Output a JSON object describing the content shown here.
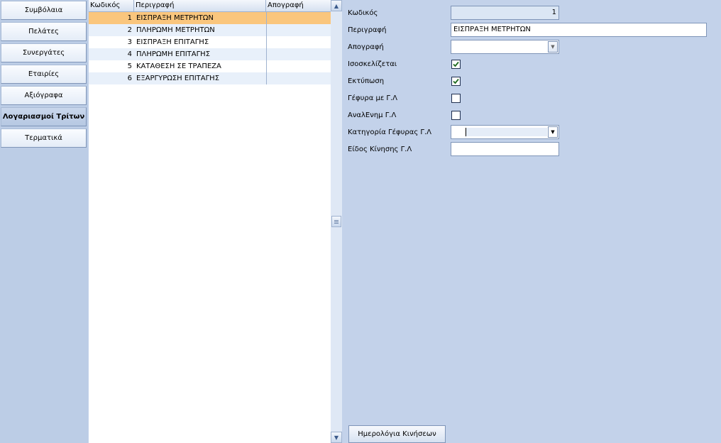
{
  "nav": {
    "items": [
      {
        "label": "Συμβόλαια"
      },
      {
        "label": "Πελάτες"
      },
      {
        "label": "Συνεργάτες"
      },
      {
        "label": "Εταιρίες"
      },
      {
        "label": "Αξιόγραφα"
      },
      {
        "label": "Λογαριασμοί Τρίτων",
        "active": true
      },
      {
        "label": "Τερματικά"
      }
    ]
  },
  "grid": {
    "columns": [
      "Κωδικός",
      "Περιγραφή",
      "Απογραφή"
    ],
    "rows": [
      {
        "code": "1",
        "description": "ΕΙΣΠΡΑΞΗ ΜΕΤΡΗΤΩΝ",
        "inventory": "",
        "selected": true
      },
      {
        "code": "2",
        "description": "ΠΛΗΡΩΜΗ ΜΕΤΡΗΤΩΝ",
        "inventory": ""
      },
      {
        "code": "3",
        "description": "ΕΙΣΠΡΑΞΗ ΕΠΙΤΑΓΗΣ",
        "inventory": ""
      },
      {
        "code": "4",
        "description": "ΠΛΗΡΩΜΗ ΕΠΙΤΑΓΗΣ",
        "inventory": ""
      },
      {
        "code": "5",
        "description": "ΚΑΤΑΘΕΣΗ ΣΕ ΤΡΑΠΕΖΑ",
        "inventory": ""
      },
      {
        "code": "6",
        "description": "ΕΞΑΡΓΥΡΩΣΗ ΕΠΙΤΑΓΗΣ",
        "inventory": ""
      }
    ]
  },
  "form": {
    "code_label": "Κωδικός",
    "code_value": "1",
    "description_label": "Περιγραφή",
    "description_value": "ΕΙΣΠΡΑΞΗ ΜΕΤΡΗΤΩΝ",
    "inventory_label": "Απογραφή",
    "inventory_value": "",
    "balanced_label": "Ισοσκελίζεται",
    "balanced_checked": true,
    "print_label": "Εκτύπωση",
    "print_checked": true,
    "gl_bridge_label": "Γέφυρα με Γ.Λ",
    "gl_bridge_checked": false,
    "analytic_label": "ΑναλΕνημ Γ.Λ",
    "analytic_checked": false,
    "bridge_category_label": "Κατηγορία Γέφυρας Γ.Λ",
    "bridge_category_value": "",
    "movement_type_label": "Είδος Κίνησης Γ.Λ",
    "movement_type_value": ""
  },
  "buttons": {
    "movement_journals": "Ημερολόγια Κινήσεων"
  },
  "colors": {
    "background": "#c3d2ea",
    "selected_row": "#fac67d",
    "alt_row": "#e8f0fa"
  }
}
